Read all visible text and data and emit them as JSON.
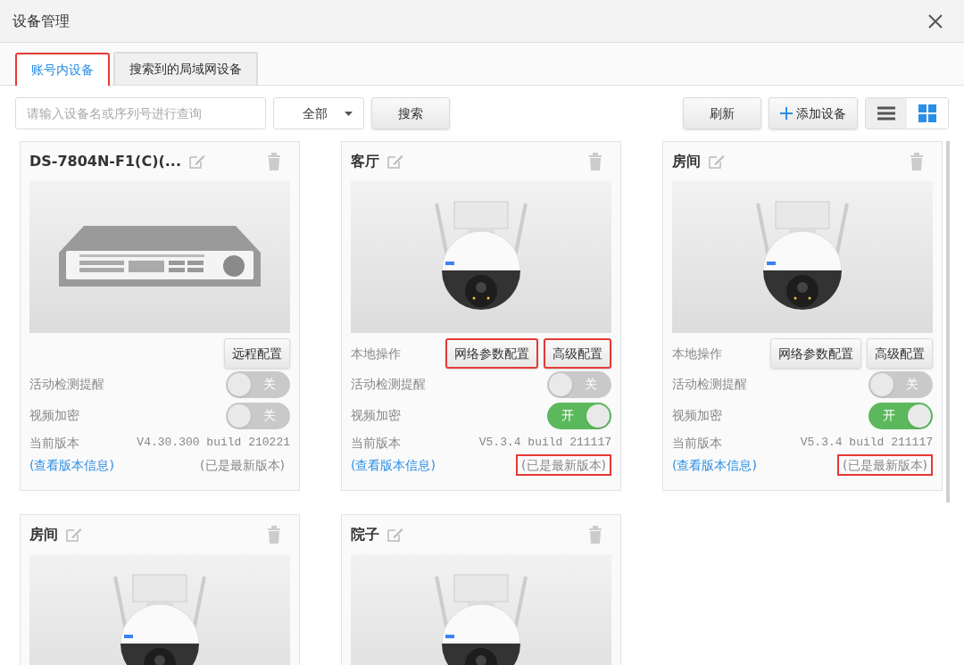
{
  "window": {
    "title": "设备管理"
  },
  "tabs": [
    {
      "label": "账号内设备",
      "selected": true,
      "highlighted": true
    },
    {
      "label": "搜索到的局域网设备",
      "selected": false,
      "highlighted": false
    }
  ],
  "toolbar": {
    "search": {
      "placeholder": "请输入设备名或序列号进行查询"
    },
    "filter": {
      "value": "全部"
    },
    "search_button": "搜索",
    "refresh_button": "刷新",
    "add_button": "添加设备",
    "view": {
      "list_selected": false,
      "grid_selected": true
    }
  },
  "devices": [
    {
      "name": "DS-7804N-F1(C)(...",
      "kind": "nvr",
      "ops": [
        {
          "label": "远程配置",
          "highlighted": false
        }
      ],
      "toggles": [
        {
          "label": "活动检测提醒",
          "on": false,
          "text": "关"
        },
        {
          "label": "视频加密",
          "on": false,
          "text": "关"
        }
      ],
      "version_label": "当前版本",
      "version": "V4.30.300 build 210221",
      "version_link": "(查看版本信息)",
      "status": "(已是最新版本)",
      "status_highlighted": false
    },
    {
      "name": "客厅",
      "kind": "camera",
      "ops_label": "本地操作",
      "ops": [
        {
          "label": "网络参数配置",
          "highlighted": true
        },
        {
          "label": "高级配置",
          "highlighted": true
        }
      ],
      "toggles": [
        {
          "label": "活动检测提醒",
          "on": false,
          "text": "关"
        },
        {
          "label": "视频加密",
          "on": true,
          "text": "开"
        }
      ],
      "version_label": "当前版本",
      "version": "V5.3.4 build 211117",
      "version_link": "(查看版本信息)",
      "status": "(已是最新版本)",
      "status_highlighted": true
    },
    {
      "name": "房间",
      "kind": "camera",
      "ops_label": "本地操作",
      "ops": [
        {
          "label": "网络参数配置",
          "highlighted": false
        },
        {
          "label": "高级配置",
          "highlighted": false
        }
      ],
      "toggles": [
        {
          "label": "活动检测提醒",
          "on": false,
          "text": "关"
        },
        {
          "label": "视频加密",
          "on": true,
          "text": "开"
        }
      ],
      "version_label": "当前版本",
      "version": "V5.3.4 build 211117",
      "version_link": "(查看版本信息)",
      "status": "(已是最新版本)",
      "status_highlighted": true
    },
    {
      "name": "房间",
      "kind": "camera"
    },
    {
      "name": "院子",
      "kind": "camera"
    }
  ]
}
